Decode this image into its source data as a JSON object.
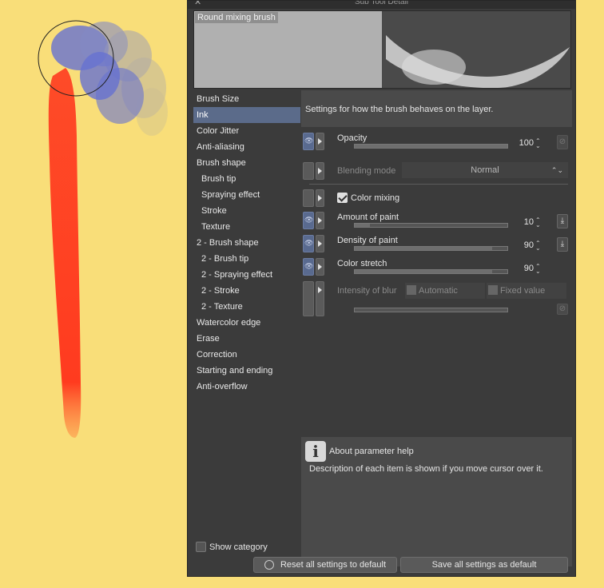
{
  "window": {
    "title": "Sub Tool Detail",
    "close_icon": "close-icon"
  },
  "preview": {
    "tool_name": "Round mixing brush"
  },
  "sidebar": {
    "items": [
      {
        "label": "Brush Size"
      },
      {
        "label": "Ink",
        "selected": true
      },
      {
        "label": "Color Jitter"
      },
      {
        "label": "Anti-aliasing"
      },
      {
        "label": "Brush shape"
      },
      {
        "label": "Brush tip",
        "sub": true
      },
      {
        "label": "Spraying effect",
        "sub": true
      },
      {
        "label": "Stroke",
        "sub": true
      },
      {
        "label": "Texture",
        "sub": true
      },
      {
        "label": "2 - Brush shape"
      },
      {
        "label": "2 - Brush tip",
        "sub": true
      },
      {
        "label": "2 - Spraying effect",
        "sub": true
      },
      {
        "label": "2 - Stroke",
        "sub": true
      },
      {
        "label": "2 - Texture",
        "sub": true
      },
      {
        "label": "Watercolor edge"
      },
      {
        "label": "Erase"
      },
      {
        "label": "Correction"
      },
      {
        "label": "Starting and ending"
      },
      {
        "label": "Anti-overflow"
      }
    ],
    "show_category_label": "Show category",
    "show_category_checked": false
  },
  "description": "Settings for how the brush behaves on the layer.",
  "params": {
    "opacity": {
      "label": "Opacity",
      "value": "100",
      "fraction": 1.0
    },
    "blending_mode": {
      "label": "Blending mode",
      "value": "Normal"
    },
    "color_mixing": {
      "label": "Color mixing",
      "checked": true
    },
    "amount_of_paint": {
      "label": "Amount of paint",
      "value": "10",
      "fraction": 0.1
    },
    "density_of_paint": {
      "label": "Density of paint",
      "value": "90",
      "fraction": 0.9
    },
    "color_stretch": {
      "label": "Color stretch",
      "value": "90",
      "fraction": 0.9
    },
    "intensity_of_blur": {
      "label": "Intensity of blur",
      "option_auto": "Automatic",
      "option_fixed": "Fixed value"
    }
  },
  "help": {
    "title": "About parameter help",
    "text": "Description of each item is shown if you move cursor over it."
  },
  "buttons": {
    "reset": "Reset all settings to default",
    "save": "Save all settings as default"
  },
  "colors": {
    "canvas_bg": "#f9de79",
    "stroke_red": "#ff3b1f",
    "stroke_blue": "#4d5fe0",
    "panel_bg": "#3b3b3b",
    "selection": "#5b6b8a"
  }
}
